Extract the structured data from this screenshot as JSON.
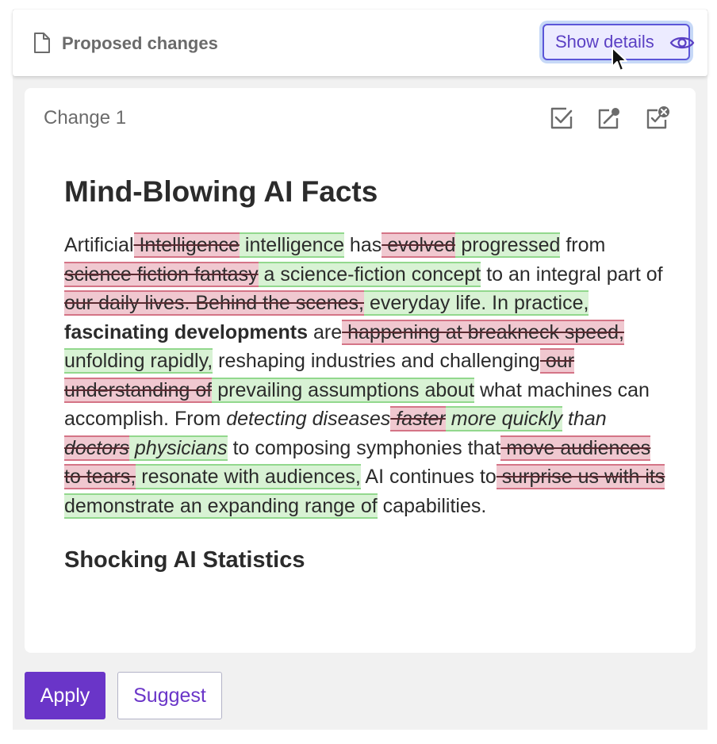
{
  "header": {
    "title": "Proposed changes",
    "show_details_label": "Show details"
  },
  "change": {
    "label": "Change 1",
    "actions": [
      "accept-icon",
      "share-icon",
      "discard-icon"
    ]
  },
  "content": {
    "heading": "Mind-Blowing AI Facts",
    "segments": [
      {
        "type": "text",
        "text": "Artificial"
      },
      {
        "type": "del",
        "text": " Intelligence"
      },
      {
        "type": "ins",
        "text": " intelligence"
      },
      {
        "type": "text",
        "text": " has"
      },
      {
        "type": "del",
        "text": " evolved"
      },
      {
        "type": "ins",
        "text": " progressed"
      },
      {
        "type": "text",
        "text": " from "
      },
      {
        "type": "del",
        "text": "science fiction fantasy"
      },
      {
        "type": "ins",
        "text": " a science-fiction concept"
      },
      {
        "type": "text",
        "text": " to an integral part of"
      },
      {
        "type": "del",
        "text": " our daily lives. Behind the scenes,"
      },
      {
        "type": "ins",
        "text": " everyday life. In practice,"
      },
      {
        "type": "text",
        "text": " "
      },
      {
        "type": "bold",
        "text": "fascinating developments"
      },
      {
        "type": "text",
        "text": " are"
      },
      {
        "type": "del",
        "text": " happening at breakneck speed,"
      },
      {
        "type": "ins",
        "text": " unfolding rapidly,"
      },
      {
        "type": "text",
        "text": " reshaping industries and challenging"
      },
      {
        "type": "del",
        "text": " our understanding of"
      },
      {
        "type": "ins",
        "text": " prevailing assumptions about"
      },
      {
        "type": "text",
        "text": " what machines can accomplish. From "
      },
      {
        "type": "italic",
        "text": "detecting diseases"
      },
      {
        "type": "del-italic",
        "text": " faster"
      },
      {
        "type": "ins-italic",
        "text": " more quickly"
      },
      {
        "type": "italic",
        "text": " than"
      },
      {
        "type": "del-italic",
        "text": " doctors"
      },
      {
        "type": "ins-italic",
        "text": " physicians"
      },
      {
        "type": "text",
        "text": " to composing symphonies that"
      },
      {
        "type": "del",
        "text": " move audiences to tears,"
      },
      {
        "type": "ins",
        "text": " resonate with audiences,"
      },
      {
        "type": "text",
        "text": " AI continues to"
      },
      {
        "type": "del",
        "text": " surprise us with its"
      },
      {
        "type": "ins",
        "text": " demonstrate an expanding range of"
      },
      {
        "type": "text",
        "text": " capabilities."
      }
    ],
    "subheading": "Shocking AI Statistics"
  },
  "footer": {
    "apply_label": "Apply",
    "suggest_label": "Suggest"
  },
  "colors": {
    "accent": "#6a35c8",
    "deletion_bg": "#f0c8d0",
    "insertion_bg": "#d8f2d4",
    "focus_ring": "#c6d8f7"
  }
}
